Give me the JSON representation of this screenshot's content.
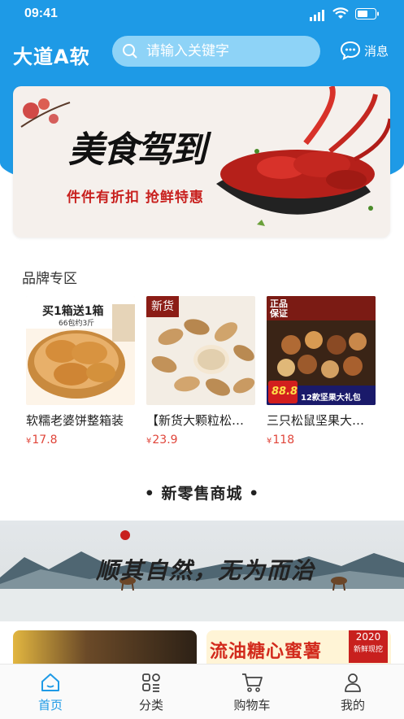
{
  "status": {
    "time": "09:41"
  },
  "header": {
    "app_name": "大道A软",
    "search_placeholder": "请输入关键字",
    "message_label": "消息"
  },
  "banner": {
    "title": "美食驾到",
    "subtitle": "件件有折扣  抢鲜特惠"
  },
  "brand_section": {
    "title": "品牌专区",
    "products": [
      {
        "name": "软糯老婆饼整箱装",
        "price": "17.8",
        "currency": "¥",
        "image_tag": "买1箱送1箱",
        "image_tag2": "66包约3斤"
      },
      {
        "name": "【新货大颗粒松子】",
        "price": "23.9",
        "currency": "¥",
        "image_tag": "新货"
      },
      {
        "name": "三只松鼠坚果大礼包",
        "price": "118",
        "currency": "¥",
        "image_tag": "正品保证",
        "image_tag2": "12款坚果大礼包",
        "image_tag3": "88.8"
      }
    ]
  },
  "mall": {
    "title": "•  新零售商城  •",
    "banner_text": "顺其自然，无为而治"
  },
  "cards": {
    "card2_text": "流油糖心蜜薯",
    "card2_badge": "2020",
    "card2_badge_sub": "新鲜现挖"
  },
  "tabbar": {
    "items": [
      {
        "label": "首页",
        "icon": "home-icon",
        "active": true
      },
      {
        "label": "分类",
        "icon": "category-icon",
        "active": false
      },
      {
        "label": "购物车",
        "icon": "cart-icon",
        "active": false
      },
      {
        "label": "我的",
        "icon": "user-icon",
        "active": false
      }
    ]
  },
  "colors": {
    "primary": "#1e9ae6",
    "price": "#e0453a"
  }
}
